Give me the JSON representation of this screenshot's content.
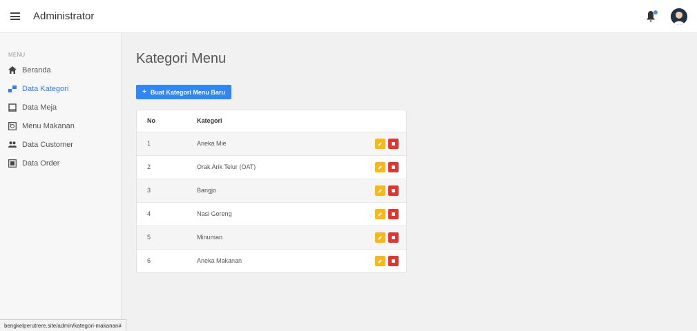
{
  "app": {
    "title": "Administrator"
  },
  "sidebar": {
    "section_label": "MENU",
    "items": [
      {
        "label": "Beranda",
        "icon": "home-icon",
        "active": false
      },
      {
        "label": "Data Kategori",
        "icon": "category-icon",
        "active": true
      },
      {
        "label": "Data Meja",
        "icon": "table-icon",
        "active": false
      },
      {
        "label": "Menu Makanan",
        "icon": "food-menu-icon",
        "active": false
      },
      {
        "label": "Data Customer",
        "icon": "people-icon",
        "active": false
      },
      {
        "label": "Data Order",
        "icon": "order-icon",
        "active": false
      }
    ]
  },
  "main": {
    "title": "Kategori Menu",
    "create_button": {
      "icon": "+",
      "label": "Buat Kategori Menu Baru"
    },
    "table": {
      "headers": [
        "No",
        "Kategori"
      ],
      "rows": [
        {
          "no": "1",
          "kategori": "Aneka Mie"
        },
        {
          "no": "2",
          "kategori": "Orak Arik Telur (OAT)"
        },
        {
          "no": "3",
          "kategori": "Bangjo"
        },
        {
          "no": "4",
          "kategori": "Nasi Goreng"
        },
        {
          "no": "5",
          "kategori": "Minuman"
        },
        {
          "no": "6",
          "kategori": "Aneka Makanan"
        }
      ]
    }
  },
  "statusbar": {
    "url": "bengkelperutrere.site/admin/kategori-makanan#"
  },
  "colors": {
    "accent": "#2f86f6",
    "edit": "#f8b815",
    "delete": "#e8322b"
  }
}
